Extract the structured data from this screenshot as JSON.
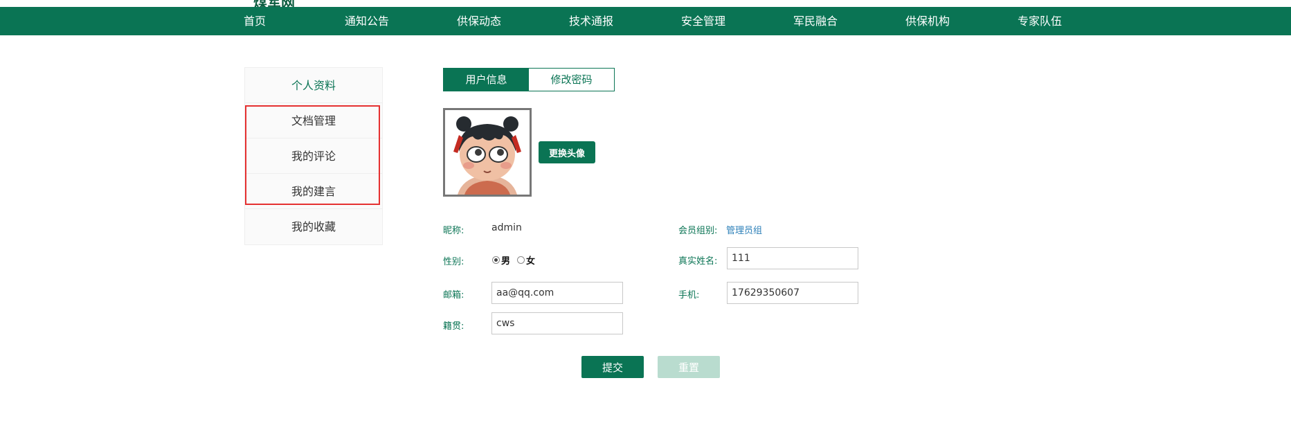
{
  "header": {
    "logo_fragment": "煤军网"
  },
  "nav": {
    "items": [
      "首页",
      "通知公告",
      "供保动态",
      "技术通报",
      "安全管理",
      "军民融合",
      "供保机构",
      "专家队伍"
    ]
  },
  "sidebar": {
    "items": [
      "个人资料",
      "文档管理",
      "我的评论",
      "我的建言",
      "我的收藏"
    ],
    "active_index": 0
  },
  "tabs": {
    "user_info": "用户信息",
    "change_password": "修改密码",
    "active": "user_info"
  },
  "avatar": {
    "change_button": "更换头像"
  },
  "form": {
    "nickname_label": "昵称:",
    "nickname_value": "admin",
    "group_label": "会员组别:",
    "group_value": "管理员组",
    "gender_label": "性别:",
    "gender_male": "男",
    "gender_female": "女",
    "gender_selected": "male",
    "realname_label": "真实姓名:",
    "realname_value": "111",
    "email_label": "邮箱:",
    "email_value": "aa@qq.com",
    "phone_label": "手机:",
    "phone_value": "17629350607",
    "hometown_label": "籍贯:",
    "hometown_value": "cws"
  },
  "actions": {
    "submit": "提交",
    "reset": "重置"
  },
  "colors": {
    "primary": "#0a7454",
    "highlight_border": "#e53030",
    "reset_disabled": "#b9dccf",
    "link": "#2b7fb8"
  }
}
